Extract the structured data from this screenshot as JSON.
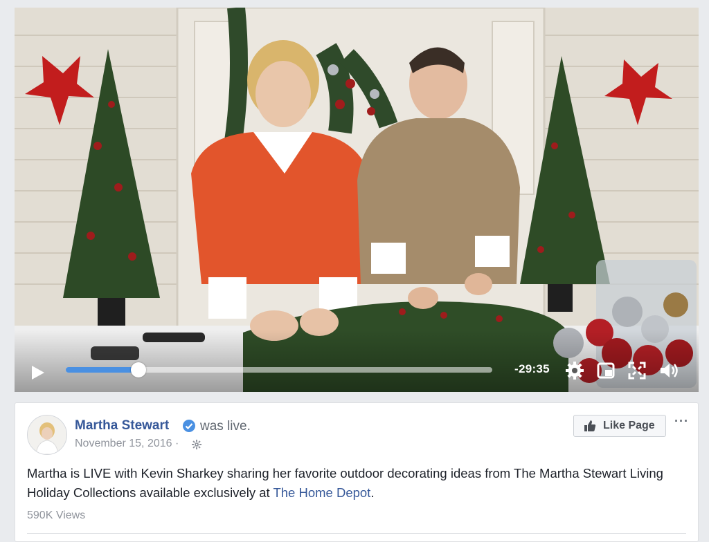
{
  "video": {
    "remaining_time": "-29:35",
    "progress_fraction": 0.17,
    "accent_color": "#4a90e2",
    "icons": [
      "play-icon",
      "settings-gear-icon",
      "picture-in-picture-icon",
      "fullscreen-icon",
      "volume-icon"
    ]
  },
  "post": {
    "author": "Martha Stewart",
    "was_live": "was live.",
    "date": "November 15, 2016",
    "date_separator": "·",
    "like_page_label": "Like Page",
    "more_label": "···",
    "text_main": "Martha is LIVE with Kevin Sharkey sharing her favorite outdoor decorating ideas from The Martha Stewart Living Holiday Collections available exclusively at ",
    "text_link": "The Home Depot",
    "text_end": ".",
    "views": "590K Views",
    "link_color": "#365899"
  }
}
